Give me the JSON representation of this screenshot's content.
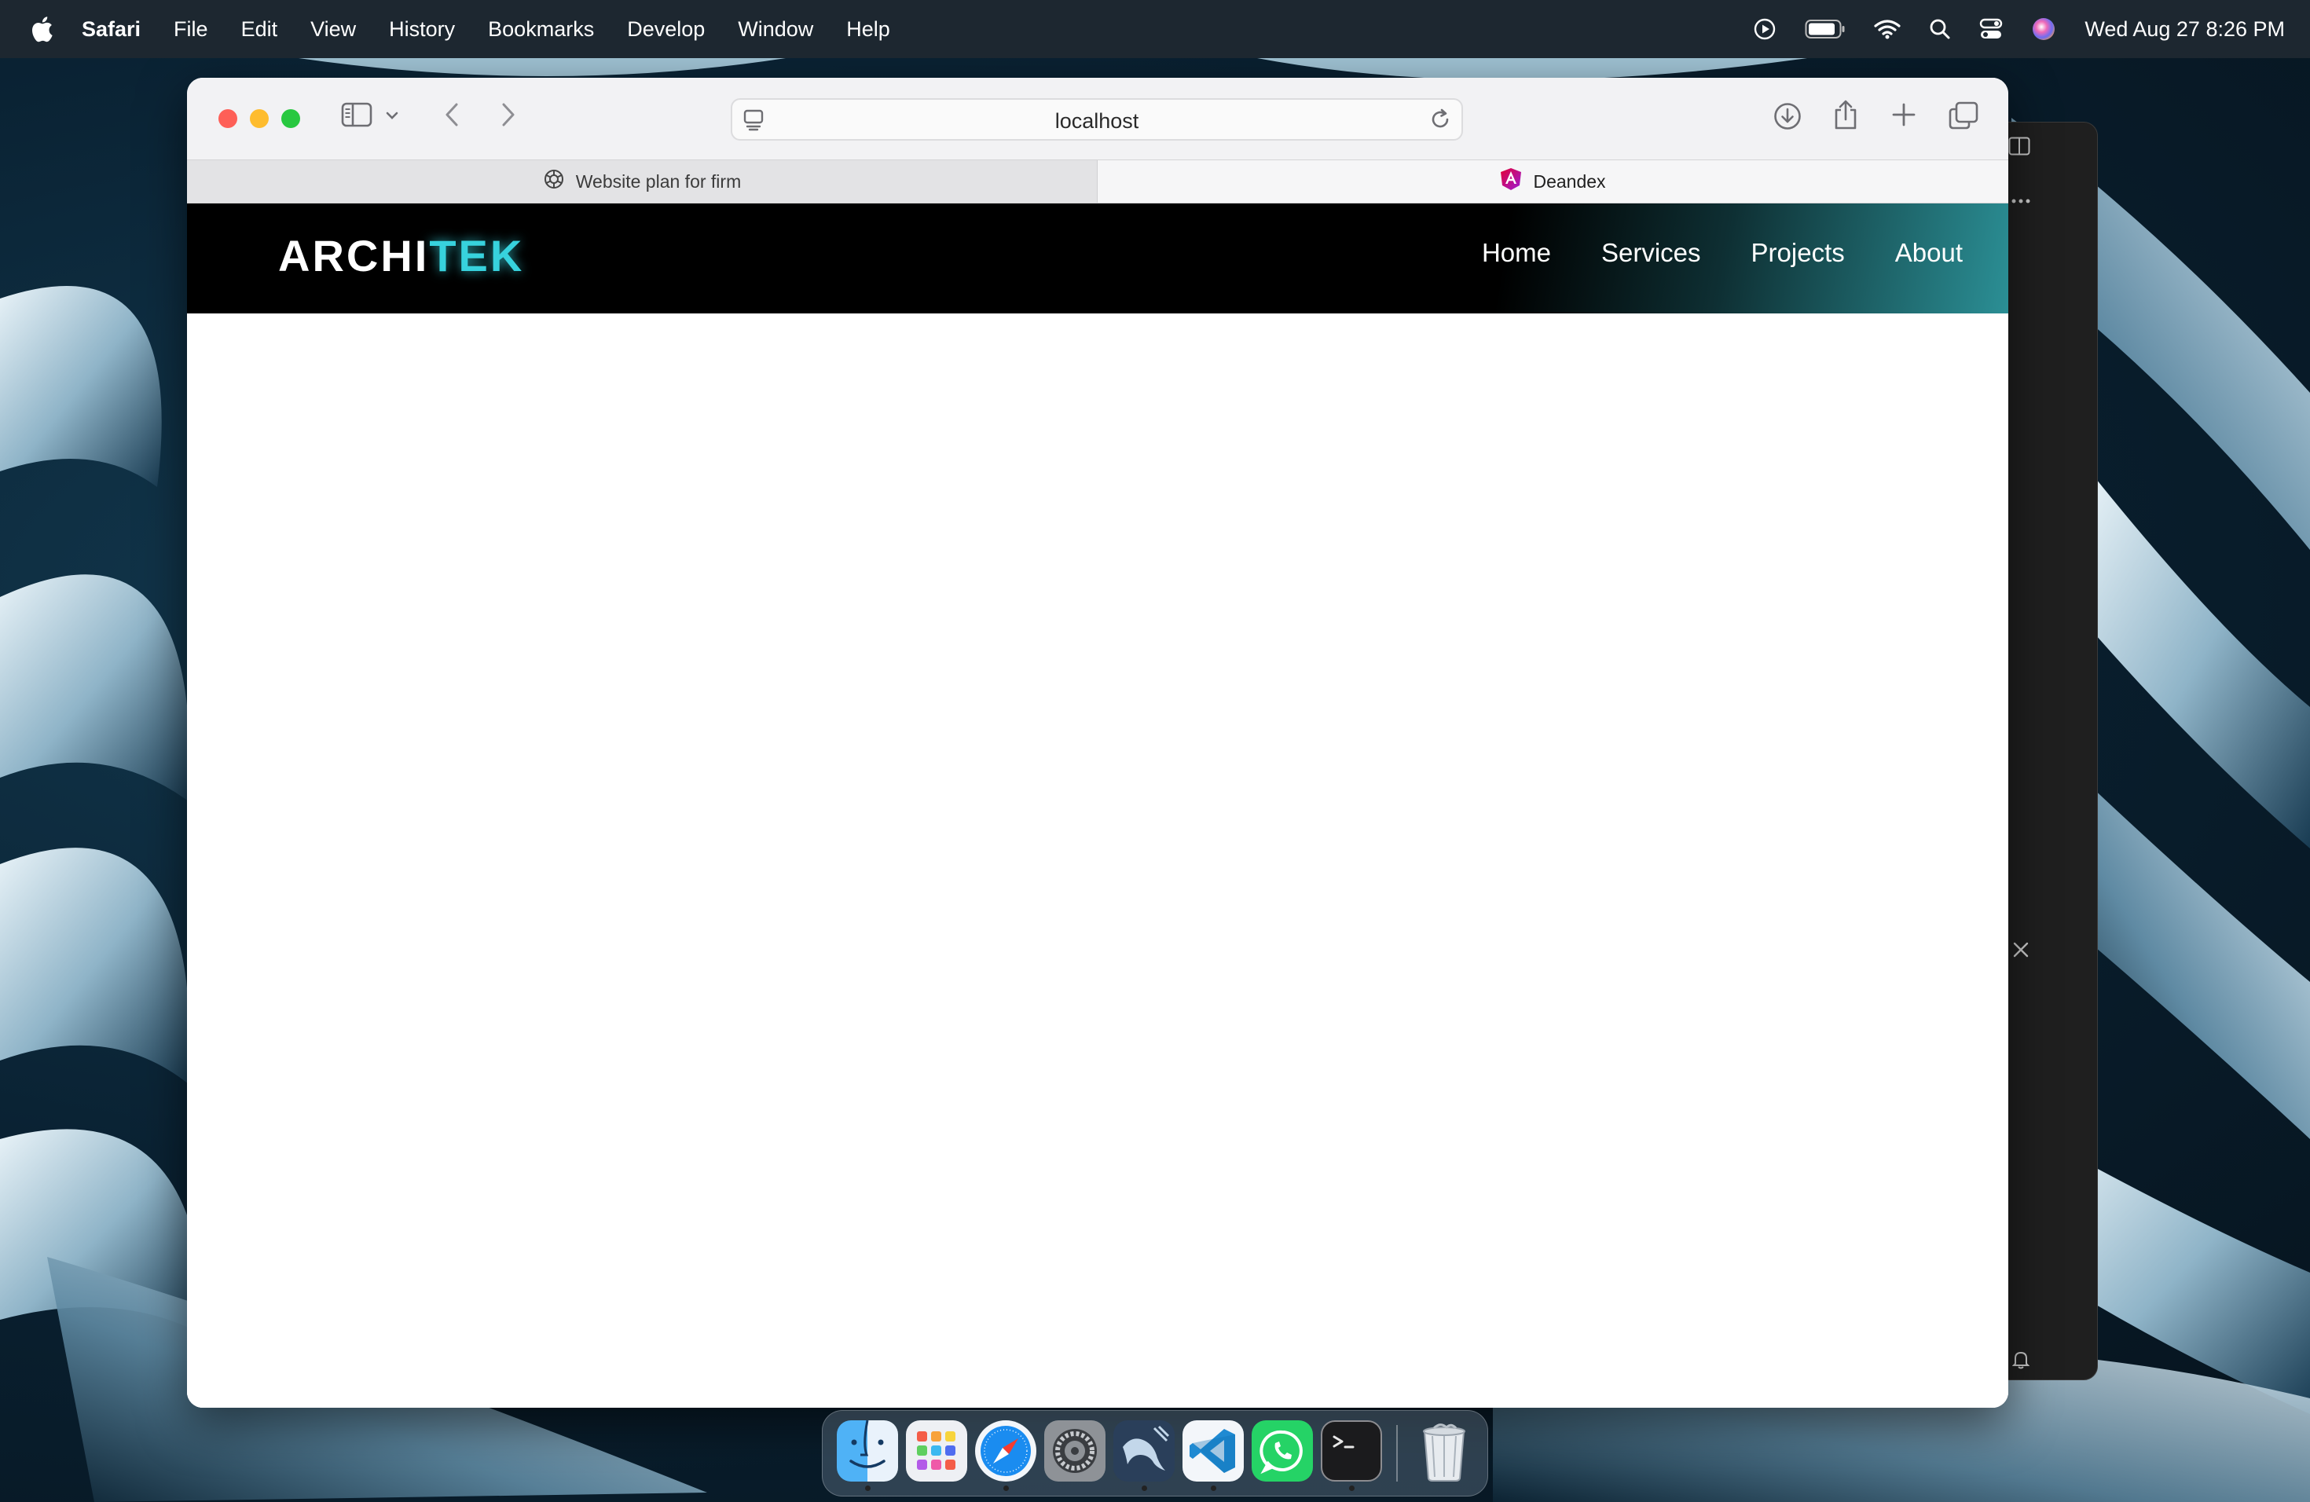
{
  "menubar": {
    "app_name": "Safari",
    "items": [
      {
        "label": "File"
      },
      {
        "label": "Edit"
      },
      {
        "label": "View"
      },
      {
        "label": "History"
      },
      {
        "label": "Bookmarks"
      },
      {
        "label": "Develop"
      },
      {
        "label": "Window"
      },
      {
        "label": "Help"
      }
    ],
    "status_icons": [
      "play-circle-icon",
      "battery-icon",
      "wifi-icon",
      "search-icon",
      "control-center-icon",
      "siri-icon"
    ],
    "clock": "Wed Aug 27  8:26 PM"
  },
  "browser": {
    "address": "localhost",
    "tabs": [
      {
        "title": "Website plan for firm",
        "icon": "openai-icon",
        "active": false
      },
      {
        "title": "Deandex",
        "icon": "angular-icon",
        "active": true
      }
    ]
  },
  "site": {
    "logo_main": "ARCHI",
    "logo_accent": "TEK",
    "accent_color": "#37d2dd",
    "nav": [
      {
        "label": "Home"
      },
      {
        "label": "Services"
      },
      {
        "label": "Projects"
      },
      {
        "label": "About"
      }
    ]
  },
  "dock": {
    "apps": [
      "finder-icon",
      "launchpad-icon",
      "safari-icon",
      "system-settings-icon",
      "mysql-workbench-icon",
      "vscode-icon",
      "whatsapp-icon",
      "terminal-icon",
      "trash-icon"
    ]
  }
}
